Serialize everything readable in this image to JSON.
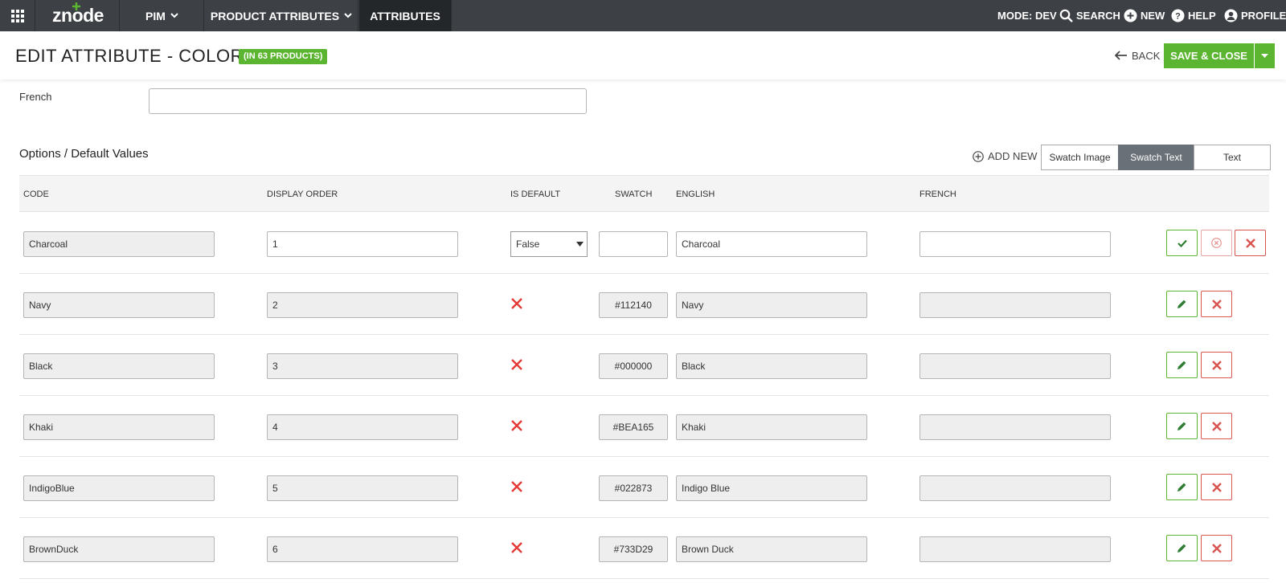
{
  "topnav": {
    "logo": "znode",
    "menu": [
      {
        "label": "PIM",
        "has_dropdown": true
      },
      {
        "label": "PRODUCT ATTRIBUTES",
        "has_dropdown": true
      },
      {
        "label": "ATTRIBUTES",
        "has_dropdown": false,
        "active": true
      }
    ],
    "mode": "MODE: DEV",
    "search": "SEARCH",
    "new": "NEW",
    "help": "HELP",
    "profile": "PROFILE"
  },
  "header": {
    "title": "EDIT ATTRIBUTE - COLOR",
    "badge": "(IN 63 PRODUCTS)",
    "back": "BACK",
    "save_close": "SAVE & CLOSE"
  },
  "locale_field": {
    "label": "French",
    "value": ""
  },
  "options": {
    "title": "Options / Default Values",
    "add_new": "ADD NEW",
    "view_modes": [
      "Swatch Image",
      "Swatch Text",
      "Text"
    ],
    "active_mode": "Swatch Text",
    "columns": [
      "CODE",
      "DISPLAY ORDER",
      "IS DEFAULT",
      "SWATCH",
      "ENGLISH",
      "FRENCH"
    ],
    "rows": [
      {
        "code": "Charcoal",
        "order": "1",
        "is_default": "False",
        "swatch": "",
        "english": "Charcoal",
        "french": "",
        "editing": true
      },
      {
        "code": "Navy",
        "order": "2",
        "is_default": "false",
        "swatch": "#112140",
        "english": "Navy",
        "french": "",
        "editing": false
      },
      {
        "code": "Black",
        "order": "3",
        "is_default": "false",
        "swatch": "#000000",
        "english": "Black",
        "french": "",
        "editing": false
      },
      {
        "code": "Khaki",
        "order": "4",
        "is_default": "false",
        "swatch": "#BEA165",
        "english": "Khaki",
        "french": "",
        "editing": false
      },
      {
        "code": "IndigoBlue",
        "order": "5",
        "is_default": "false",
        "swatch": "#022873",
        "english": "Indigo Blue",
        "french": "",
        "editing": false
      },
      {
        "code": "BrownDuck",
        "order": "6",
        "is_default": "false",
        "swatch": "#733D29",
        "english": "Brown Duck",
        "french": "",
        "editing": false
      }
    ]
  },
  "colors": {
    "nav_bg": "#3d4145",
    "accent_green": "#5cb531",
    "danger_red": "#d9534f",
    "segment_active": "#6a7077"
  },
  "icons": {
    "grid": "apps-grid-icon",
    "search": "search-icon",
    "new": "plus-circle-icon",
    "help": "help-circle-icon",
    "profile": "user-circle-icon",
    "back": "arrow-left-icon",
    "save_dropdown": "caret-down-icon",
    "confirm": "check-icon",
    "cancel": "circle-x-icon",
    "delete": "close-icon",
    "edit": "pencil-icon",
    "not_default": "x-mark-icon"
  }
}
